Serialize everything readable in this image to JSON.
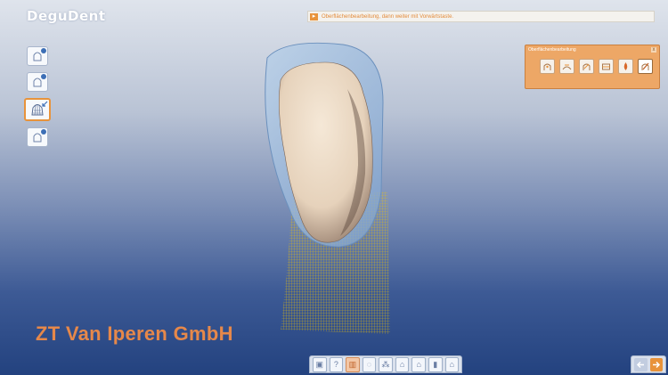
{
  "app": {
    "logo": "DeguDent"
  },
  "status": {
    "icon": "arrow-right-icon",
    "message": "Oberflächenbearbeitung, dann weiter mit Vorwärtstaste."
  },
  "left_toolbar": [
    {
      "icon": "cap-bell-icon",
      "active": false
    },
    {
      "icon": "cap-bell-dot-icon",
      "active": false
    },
    {
      "icon": "mesh-cap-icon",
      "active": true
    },
    {
      "icon": "cap-bell-plus-icon",
      "active": false
    }
  ],
  "panel": {
    "title": "Oberflächenbearbeitung",
    "close": "x",
    "tools": [
      "add-material-icon",
      "smooth-surface-icon",
      "carve-icon",
      "margin-icon",
      "drop-icon",
      "knife-icon"
    ],
    "selected_index": 5
  },
  "watermark": "ZT Van Iperen GmbH",
  "bottom_toolbar": [
    {
      "icon": "tooth-view-icon",
      "glyph": "▣"
    },
    {
      "icon": "help-icon",
      "glyph": "?"
    },
    {
      "icon": "grid-view-icon",
      "glyph": "▥"
    },
    {
      "icon": "drop-icon",
      "glyph": "◌"
    },
    {
      "icon": "measure-icon",
      "glyph": "⁂"
    },
    {
      "icon": "mesh-tooth-icon",
      "glyph": "⌂"
    },
    {
      "icon": "mesh-tooth-alt-icon",
      "glyph": "⌂"
    },
    {
      "icon": "solid-tooth-icon",
      "glyph": "▮"
    },
    {
      "icon": "tooth-outline-icon",
      "glyph": "⌂"
    }
  ],
  "nav": {
    "back_icon": "back-arrow-icon",
    "forward_icon": "forward-arrow-icon"
  },
  "colors": {
    "accent": "#e8933b",
    "panel": "#eda766",
    "mesh": "#f2c300",
    "tooth": "#eadbc7"
  }
}
